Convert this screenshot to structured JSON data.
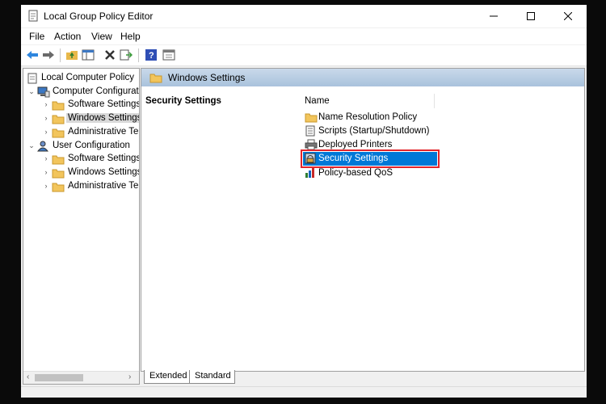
{
  "window": {
    "title": "Local Group Policy Editor"
  },
  "controls": {
    "minimize": "—",
    "maximize": "☐",
    "close": "✕"
  },
  "menu": [
    "File",
    "Action",
    "View",
    "Help"
  ],
  "toolbar": [
    "back-icon",
    "forward-icon",
    "up-folder-icon",
    "show-hide-tree-icon",
    "delete-icon",
    "export-list-icon",
    "help-icon",
    "properties-icon"
  ],
  "tree": {
    "root": "Local Computer Policy",
    "items": [
      {
        "label": "Computer Configurati",
        "expander": "⌄"
      },
      {
        "label": "Software Settings",
        "expander": "›"
      },
      {
        "label": "Windows Settings",
        "expander": "›"
      },
      {
        "label": "Administrative Te",
        "expander": "›"
      },
      {
        "label": "User Configuration",
        "expander": "⌄"
      },
      {
        "label": "Software Settings",
        "expander": "›"
      },
      {
        "label": "Windows Settings",
        "expander": "›"
      },
      {
        "label": "Administrative Te",
        "expander": "›"
      }
    ],
    "scroll_left": "‹",
    "scroll_right": "›"
  },
  "pane": {
    "header": "Windows Settings",
    "left_title": "Security Settings",
    "column": "Name",
    "items": [
      "Name Resolution Policy",
      "Scripts (Startup/Shutdown)",
      "Deployed Printers",
      "Security Settings",
      "Policy-based QoS"
    ]
  },
  "tabs": [
    "Extended",
    "Standard"
  ],
  "colors": {
    "selection": "#0078d7",
    "highlight_box": "#e3242b",
    "header_band": "#b4c9e0"
  }
}
